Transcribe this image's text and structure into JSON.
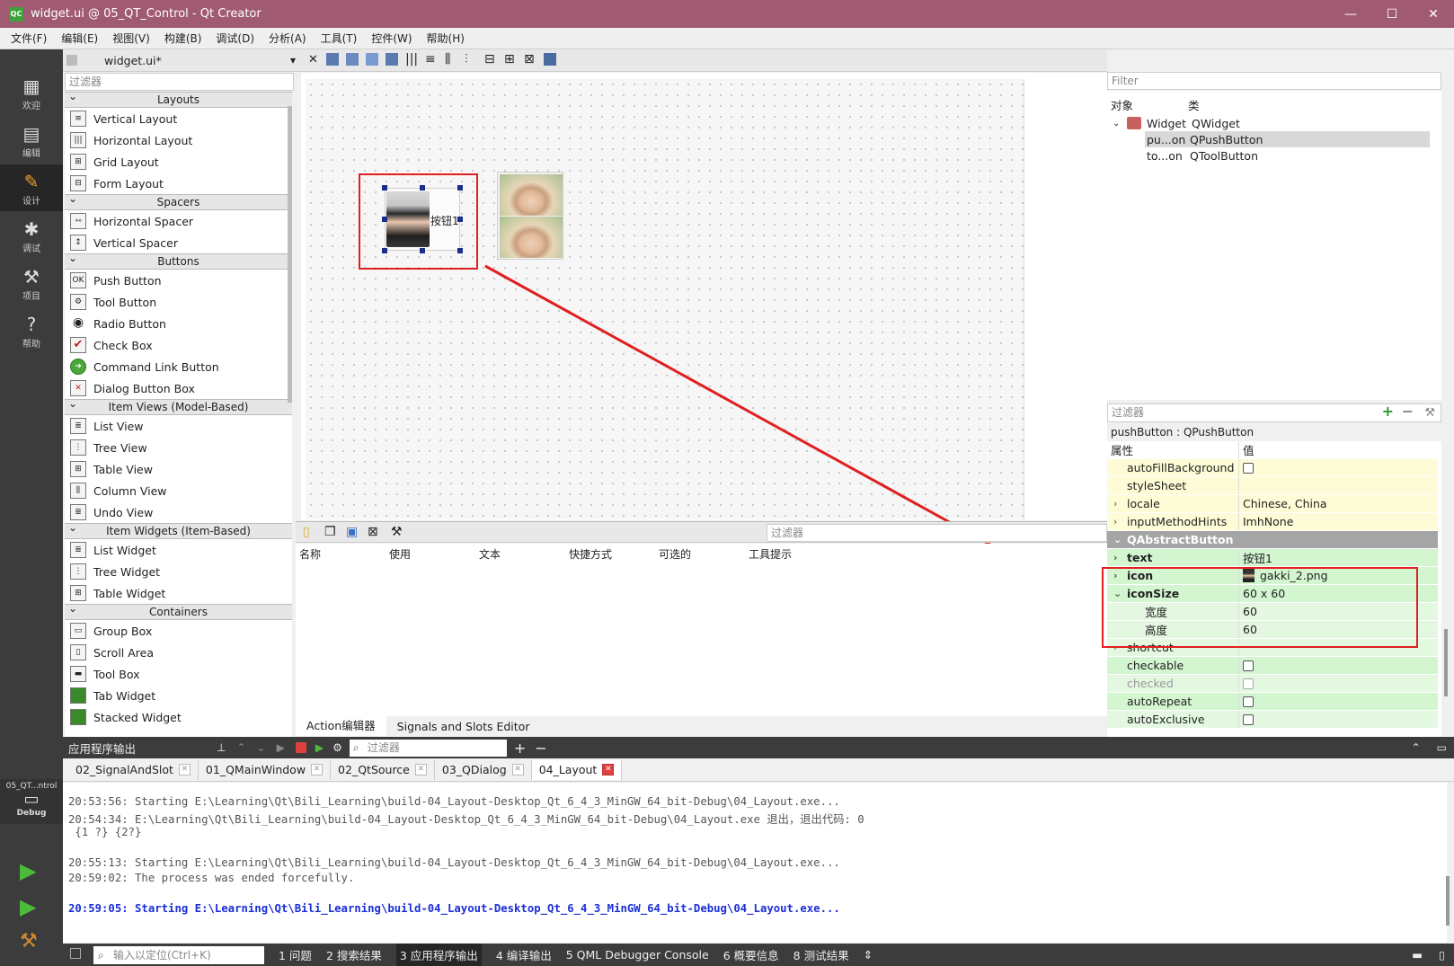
{
  "window": {
    "title": "widget.ui @ 05_QT_Control - Qt Creator",
    "app_icon": "QC"
  },
  "menu": [
    "文件(F)",
    "编辑(E)",
    "视图(V)",
    "构建(B)",
    "调试(D)",
    "分析(A)",
    "工具(T)",
    "控件(W)",
    "帮助(H)"
  ],
  "modes": {
    "welcome": "欢迎",
    "edit": "编辑",
    "design": "设计",
    "debug": "调试",
    "project": "项目",
    "help": "帮助",
    "kit_name": "05_QT...ntrol",
    "build_config": "Debug"
  },
  "editor": {
    "file_tab": "widget.ui*"
  },
  "widget_box": {
    "filter_placeholder": "过滤器",
    "categories": {
      "layouts": "Layouts",
      "spacers": "Spacers",
      "buttons": "Buttons",
      "item_views": "Item Views (Model-Based)",
      "item_widgets": "Item Widgets (Item-Based)",
      "containers": "Containers"
    },
    "items": {
      "vertical_layout": "Vertical Layout",
      "horizontal_layout": "Horizontal Layout",
      "grid_layout": "Grid Layout",
      "form_layout": "Form Layout",
      "horizontal_spacer": "Horizontal Spacer",
      "vertical_spacer": "Vertical Spacer",
      "push_button": "Push Button",
      "tool_button": "Tool Button",
      "radio_button": "Radio Button",
      "check_box": "Check Box",
      "command_link_button": "Command Link Button",
      "dialog_button_box": "Dialog Button Box",
      "list_view": "List View",
      "tree_view": "Tree View",
      "table_view": "Table View",
      "column_view": "Column View",
      "undo_view": "Undo View",
      "list_widget": "List Widget",
      "tree_widget": "Tree Widget",
      "table_widget": "Table Widget",
      "group_box": "Group Box",
      "scroll_area": "Scroll Area",
      "tool_box": "Tool Box",
      "tab_widget": "Tab Widget",
      "stacked_widget": "Stacked Widget"
    }
  },
  "form": {
    "push_button_text": "按钮1"
  },
  "action_editor": {
    "filter_placeholder": "过滤器",
    "columns": [
      "名称",
      "使用",
      "文本",
      "快捷方式",
      "可选的",
      "工具提示"
    ],
    "tabs": [
      "Action编辑器",
      "Signals and Slots Editor"
    ]
  },
  "object_inspector": {
    "filter_placeholder": "Filter",
    "col_object": "对象",
    "col_class": "类",
    "rows": [
      {
        "name": "Widget",
        "class": "QWidget"
      },
      {
        "name": "pu...on",
        "class": "QPushButton"
      },
      {
        "name": "to...on",
        "class": "QToolButton"
      }
    ]
  },
  "property_editor": {
    "filter_placeholder": "过滤器",
    "class_label": "pushButton : QPushButton",
    "col_property": "属性",
    "col_value": "值",
    "rows": {
      "auto_fill": "autoFillBackground",
      "style_sheet": "styleSheet",
      "locale": "locale",
      "locale_value": "Chinese, China",
      "input_hints": "inputMethodHints",
      "input_hints_value": "ImhNone",
      "group": "QAbstractButton",
      "text": "text",
      "text_value": "按钮1",
      "icon": "icon",
      "icon_value": "gakki_2.png",
      "icon_size": "iconSize",
      "icon_size_value": "60 x 60",
      "width": "宽度",
      "width_value": "60",
      "height": "高度",
      "height_value": "60",
      "shortcut": "shortcut",
      "checkable": "checkable",
      "checked": "checked",
      "auto_repeat": "autoRepeat",
      "auto_exclusive": "autoExclusive"
    }
  },
  "output": {
    "title": "应用程序输出",
    "filter_placeholder": "过滤器",
    "tabs": [
      "02_SignalAndSlot",
      "01_QMainWindow",
      "02_QtSource",
      "03_QDialog",
      "04_Layout"
    ],
    "lines": [
      "20:53:56: Starting E:\\Learning\\Qt\\Bili_Learning\\build-04_Layout-Desktop_Qt_6_4_3_MinGW_64_bit-Debug\\04_Layout.exe...",
      "20:54:34: E:\\Learning\\Qt\\Bili_Learning\\build-04_Layout-Desktop_Qt_6_4_3_MinGW_64_bit-Debug\\04_Layout.exe 退出，退出代码: 0",
      " {1 ?} {2?}",
      "",
      "20:55:13: Starting E:\\Learning\\Qt\\Bili_Learning\\build-04_Layout-Desktop_Qt_6_4_3_MinGW_64_bit-Debug\\04_Layout.exe...",
      "20:59:02: The process was ended forcefully.",
      "",
      "20:59:05: Starting E:\\Learning\\Qt\\Bili_Learning\\build-04_Layout-Desktop_Qt_6_4_3_MinGW_64_bit-Debug\\04_Layout.exe..."
    ]
  },
  "statusbar": {
    "locator_placeholder": "输入以定位(Ctrl+K)",
    "panes": [
      "1 问题",
      "2 搜索结果",
      "3 应用程序输出",
      "4 编译输出",
      "5 QML Debugger Console",
      "6 概要信息",
      "8 测试结果"
    ]
  },
  "colors": {
    "title_bar": "#a05a72",
    "mode_bar": "#3c3c3c",
    "annotation": "#e02020",
    "output_highlight": "#1a2ed8"
  }
}
